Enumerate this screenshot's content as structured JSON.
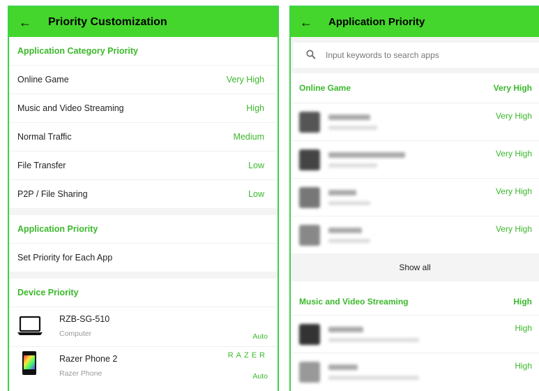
{
  "left": {
    "title": "Priority Customization",
    "category_header": "Application Category Priority",
    "categories": [
      {
        "label": "Online Game",
        "value": "Very High"
      },
      {
        "label": "Music and Video Streaming",
        "value": "High"
      },
      {
        "label": "Normal Traffic",
        "value": "Medium"
      },
      {
        "label": "File Transfer",
        "value": "Low"
      },
      {
        "label": "P2P / File Sharing",
        "value": "Low"
      }
    ],
    "app_priority_header": "Application Priority",
    "set_each_app": "Set Priority for Each App",
    "device_header": "Device Priority",
    "devices": [
      {
        "name": "RZB-SG-510",
        "type": "Computer",
        "value": "Auto",
        "icon": "laptop-icon"
      },
      {
        "name": "Razer Phone 2",
        "type": "Razer Phone",
        "value": "Auto",
        "brand": "RAZER",
        "icon": "phone-icon"
      }
    ]
  },
  "right": {
    "title": "Application Priority",
    "search_placeholder": "Input keywords to search apps",
    "sections": [
      {
        "name": "Online Game",
        "value": "Very High",
        "apps": [
          {
            "value": "Very High"
          },
          {
            "value": "Very High"
          },
          {
            "value": "Very High"
          },
          {
            "value": "Very High"
          }
        ],
        "show_all": "Show all"
      },
      {
        "name": "Music and Video Streaming",
        "value": "High",
        "apps": [
          {
            "value": "High"
          },
          {
            "value": "High"
          }
        ]
      }
    ]
  },
  "colors": {
    "accent": "#44d62c",
    "accent_text": "#3bb82b"
  },
  "icons": {
    "back": "arrow-left-icon",
    "search": "search-icon"
  }
}
